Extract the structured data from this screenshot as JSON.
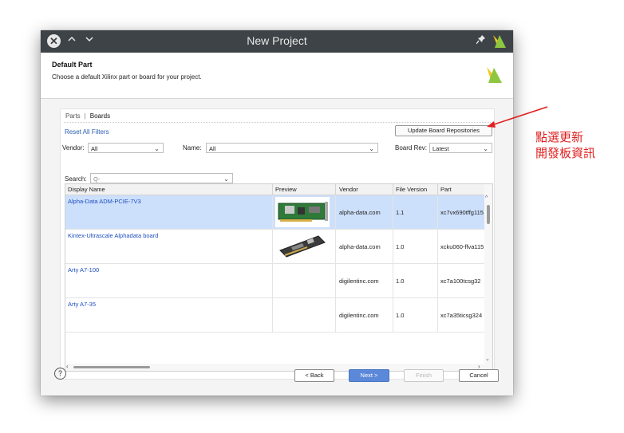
{
  "window": {
    "title": "New Project",
    "titlebar_icons": [
      "close-icon",
      "chevron-up-icon",
      "chevron-down-icon",
      "pin-icon",
      "vivado-logo-icon"
    ]
  },
  "header": {
    "title": "Default Part",
    "subtitle": "Choose a default Xilinx part or board for your project."
  },
  "tabs": {
    "parts": "Parts",
    "separator": "|",
    "boards": "Boards",
    "active": "Boards"
  },
  "filters": {
    "reset_link": "Reset All Filters",
    "update_button": "Update Board Repositories",
    "vendor_label": "Vendor:",
    "vendor_value": "All",
    "name_label": "Name:",
    "name_value": "All",
    "board_rev_label": "Board Rev:",
    "board_rev_value": "Latest",
    "search_label": "Search:",
    "search_placeholder": "Q-"
  },
  "table": {
    "columns": [
      "Display Name",
      "Preview",
      "Vendor",
      "File Version",
      "Part"
    ],
    "rows": [
      {
        "display_name": "Alpha-Data ADM-PCIE-7V3",
        "vendor": "alpha-data.com",
        "file_version": "1.1",
        "part": "xc7vx690tffg115",
        "selected": true
      },
      {
        "display_name": "Kintex-Ultrascale Alphadata board",
        "vendor": "alpha-data.com",
        "file_version": "1.0",
        "part": "xcku060-ffva115",
        "selected": false
      },
      {
        "display_name": "Arty A7-100",
        "vendor": "digilentinc.com",
        "file_version": "1.0",
        "part": "xc7a100tcsg32",
        "selected": false
      },
      {
        "display_name": "Arty A7-35",
        "vendor": "digilentinc.com",
        "file_version": "1.0",
        "part": "xc7a35ticsg324",
        "selected": false
      }
    ]
  },
  "footer": {
    "help": "?",
    "back": "< Back",
    "next": "Next >",
    "finish": "Finish",
    "cancel": "Cancel"
  },
  "annotation": {
    "line1": "點選更新",
    "line2": "開發板資訊",
    "color": "#e02020"
  },
  "colors": {
    "titlebar": "#3d4347",
    "accent": "#5b88d9",
    "selection": "#cde0fb",
    "link": "#2a5db0"
  }
}
